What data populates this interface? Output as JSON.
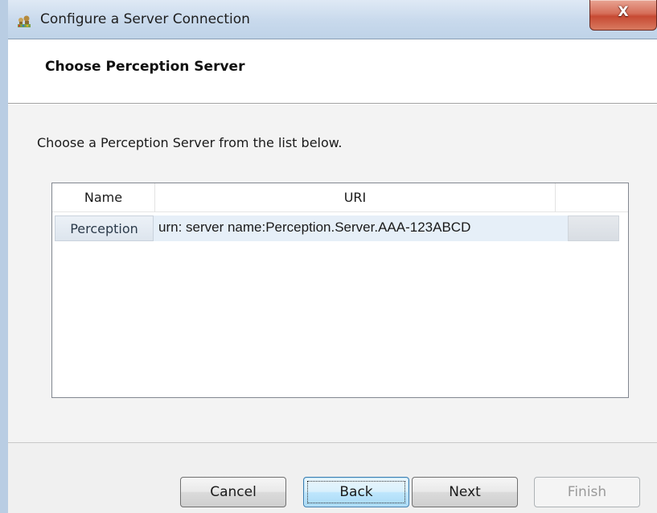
{
  "window": {
    "title": "Configure a Server Connection",
    "icon": "app-cluster-icon",
    "close_glyph": "X"
  },
  "header": {
    "title": "Choose Perception Server"
  },
  "main": {
    "instruction": "Choose a Perception Server from the list below.",
    "list": {
      "columns": [
        "Name",
        "URI",
        ""
      ],
      "rows": [
        {
          "name": "Perception",
          "uri": "urn: server name:Perception.Server.AAA-123ABCD",
          "selected": true
        }
      ]
    }
  },
  "footer": {
    "buttons": {
      "cancel": "Cancel",
      "back": "Back",
      "next": "Next",
      "finish": "Finish"
    },
    "finish_disabled": true
  },
  "colors": {
    "selection": "#e1ebf5",
    "close_red": "#c74a33",
    "focus_blue": "#3c7fb1"
  }
}
